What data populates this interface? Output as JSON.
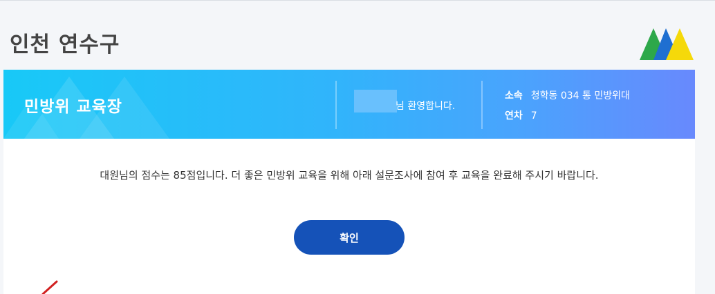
{
  "header": {
    "title": "인천 연수구"
  },
  "banner": {
    "title": "민방위 교육장",
    "welcome_suffix": "님 환영합니다.",
    "affiliation_label": "소속",
    "affiliation_value": "청학동 034 통 민방위대",
    "year_label": "연차",
    "year_value": "7"
  },
  "main": {
    "message": "대원님의 점수는 85점입니다. 더 좋은 민방위 교육을 위해 아래 설문조사에 참여 후 교육을 완료해 주시기 바랍니다.",
    "confirm_label": "확인"
  },
  "colors": {
    "banner_start": "#18c9f7",
    "banner_end": "#6889fd",
    "button": "#1552b8"
  }
}
